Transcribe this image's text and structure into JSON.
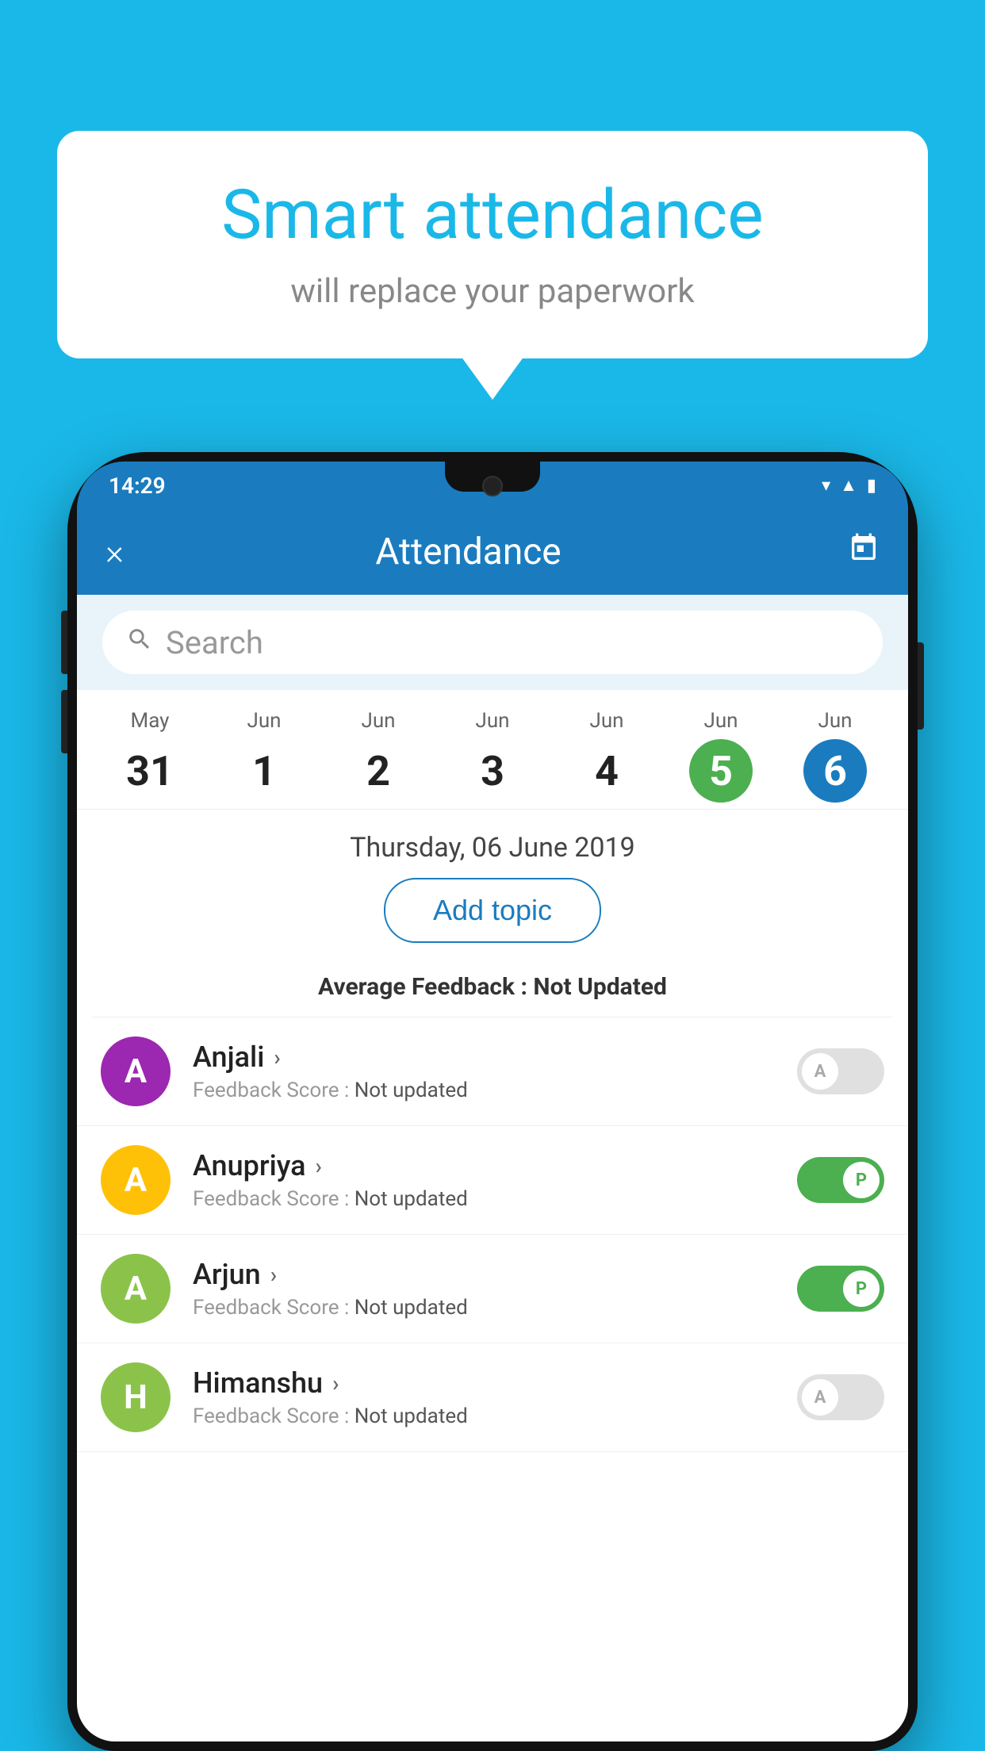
{
  "background": {
    "color": "#1ab8e8"
  },
  "speech_bubble": {
    "title": "Smart attendance",
    "subtitle": "will replace your paperwork"
  },
  "phone": {
    "status_bar": {
      "time": "14:29",
      "icons": [
        "wifi",
        "signal",
        "battery"
      ]
    },
    "header": {
      "title": "Attendance",
      "close_label": "×",
      "calendar_icon": "📅"
    },
    "search": {
      "placeholder": "Search"
    },
    "calendar": {
      "days": [
        {
          "month": "May",
          "date": "31",
          "state": "normal"
        },
        {
          "month": "Jun",
          "date": "1",
          "state": "normal"
        },
        {
          "month": "Jun",
          "date": "2",
          "state": "normal"
        },
        {
          "month": "Jun",
          "date": "3",
          "state": "normal"
        },
        {
          "month": "Jun",
          "date": "4",
          "state": "normal"
        },
        {
          "month": "Jun",
          "date": "5",
          "state": "today"
        },
        {
          "month": "Jun",
          "date": "6",
          "state": "selected"
        }
      ]
    },
    "selected_date": "Thursday, 06 June 2019",
    "add_topic_label": "Add topic",
    "avg_feedback_label": "Average Feedback :",
    "avg_feedback_value": "Not Updated",
    "students": [
      {
        "name": "Anjali",
        "avatar_letter": "A",
        "avatar_color": "#9c27b0",
        "score_label": "Feedback Score :",
        "score_value": "Not updated",
        "attendance": "absent",
        "toggle_label": "A"
      },
      {
        "name": "Anupriya",
        "avatar_letter": "A",
        "avatar_color": "#ffc107",
        "score_label": "Feedback Score :",
        "score_value": "Not updated",
        "attendance": "present",
        "toggle_label": "P"
      },
      {
        "name": "Arjun",
        "avatar_letter": "A",
        "avatar_color": "#8bc34a",
        "score_label": "Feedback Score :",
        "score_value": "Not updated",
        "attendance": "present",
        "toggle_label": "P"
      },
      {
        "name": "Himanshu",
        "avatar_letter": "H",
        "avatar_color": "#8bc34a",
        "score_label": "Feedback Score :",
        "score_value": "Not updated",
        "attendance": "absent",
        "toggle_label": "A"
      }
    ]
  }
}
